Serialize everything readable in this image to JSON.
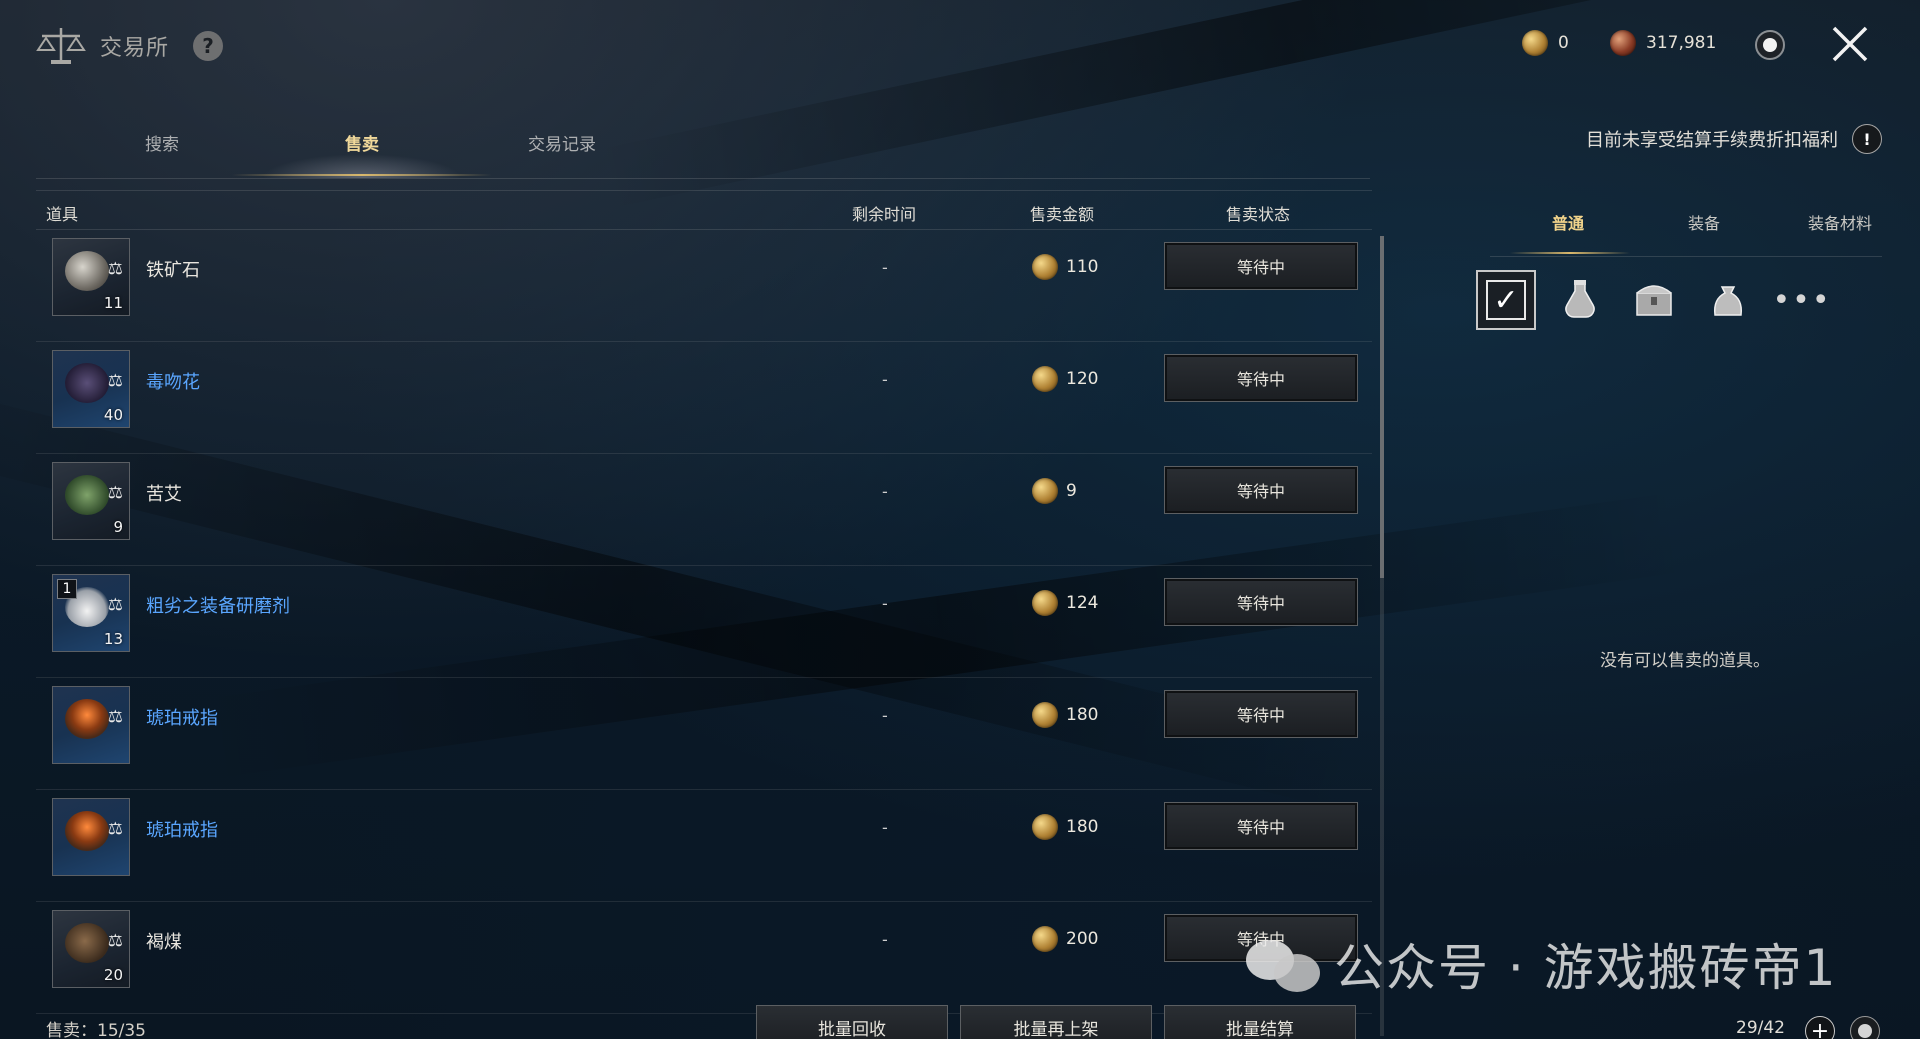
{
  "header": {
    "title": "交易所",
    "help_label": "?",
    "currency": [
      {
        "icon": "gold-coin-icon",
        "value": "0"
      },
      {
        "icon": "copper-coin-icon",
        "value": "317,981"
      }
    ]
  },
  "tabs": [
    {
      "label": "搜索",
      "active": false
    },
    {
      "label": "售卖",
      "active": true
    },
    {
      "label": "交易记录",
      "active": false
    }
  ],
  "notice": {
    "text": "目前未享受结算手续费折扣福利",
    "icon_label": "!"
  },
  "table": {
    "headers": {
      "item": "道具",
      "time": "剩余时间",
      "price": "售卖金额",
      "status": "售卖状态"
    },
    "rows": [
      {
        "name": "铁矿石",
        "rare": false,
        "count": "11",
        "badge": "",
        "time": "-",
        "price": "110",
        "status": "等待中",
        "art": "ore-icon"
      },
      {
        "name": "毒吻花",
        "rare": true,
        "count": "40",
        "badge": "",
        "time": "-",
        "price": "120",
        "status": "等待中",
        "art": "flower-icon"
      },
      {
        "name": "苦艾",
        "rare": false,
        "count": "9",
        "badge": "",
        "time": "-",
        "price": "9",
        "status": "等待中",
        "art": "herb-icon"
      },
      {
        "name": "粗劣之装备研磨剂",
        "rare": true,
        "count": "13",
        "badge": "1",
        "time": "-",
        "price": "124",
        "status": "等待中",
        "art": "powder-icon"
      },
      {
        "name": "琥珀戒指",
        "rare": true,
        "count": "",
        "badge": "",
        "time": "-",
        "price": "180",
        "status": "等待中",
        "art": "ring-icon"
      },
      {
        "name": "琥珀戒指",
        "rare": true,
        "count": "",
        "badge": "",
        "time": "-",
        "price": "180",
        "status": "等待中",
        "art": "ring-icon"
      },
      {
        "name": "褐煤",
        "rare": false,
        "count": "20",
        "badge": "",
        "time": "-",
        "price": "200",
        "status": "等待中",
        "art": "coal-icon"
      }
    ]
  },
  "footer": {
    "sold_label": "售卖：15/35",
    "bulk_buttons": [
      "批量回收",
      "批量再上架",
      "批量结算"
    ]
  },
  "right_panel": {
    "category_tabs": [
      {
        "label": "普通",
        "active": true
      },
      {
        "label": "装备",
        "active": false
      },
      {
        "label": "装备材料",
        "active": false
      }
    ],
    "filters": [
      "select-all-icon",
      "potion-icon",
      "chest-icon",
      "bag-icon",
      "more-icon"
    ],
    "empty_message": "没有可以售卖的道具。",
    "page_count": "29/42",
    "plus_label": "+"
  },
  "watermark": "公众号 · 游戏搬砖帝1",
  "colors": {
    "accent_gold": "#d9b86c",
    "rare_blue": "#5aa6ff",
    "text": "#e9e6df"
  }
}
